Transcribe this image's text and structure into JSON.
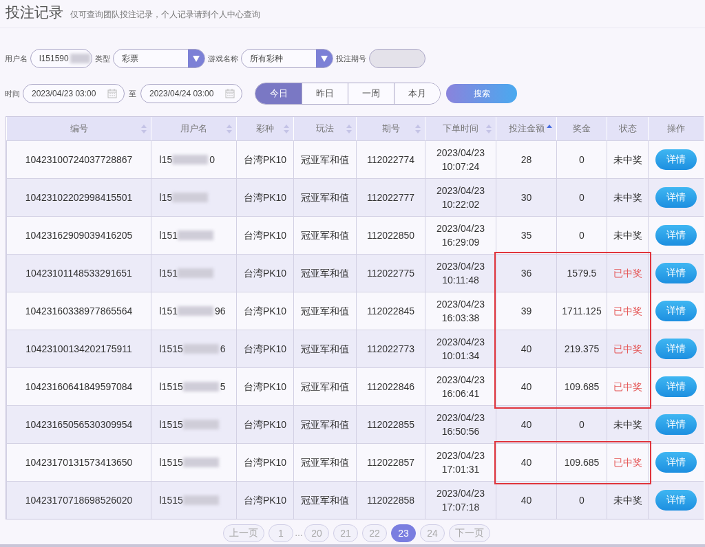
{
  "title": "投注记录",
  "subtitle": "仅可查询团队投注记录，个人记录请到个人中心查询",
  "filters": {
    "username_label": "用户名",
    "username_value": "l151590",
    "type_label": "类型",
    "type_value": "彩票",
    "game_label": "游戏名称",
    "game_value": "所有彩种",
    "period_label": "投注期号",
    "time_label": "时间",
    "start": "2023/04/23 03:00",
    "to_label": "至",
    "end": "2023/04/24 03:00",
    "ranges": [
      {
        "label": "今日",
        "selected": true
      },
      {
        "label": "昨日",
        "selected": false
      },
      {
        "label": "一周",
        "selected": false
      },
      {
        "label": "本月",
        "selected": false
      }
    ],
    "search": "搜索"
  },
  "table": {
    "columns": [
      {
        "label": "编号",
        "kind": "sortable",
        "sorted": false
      },
      {
        "label": "用户名",
        "kind": "sortable",
        "sorted": false
      },
      {
        "label": "彩种",
        "kind": "sortable",
        "sorted": false
      },
      {
        "label": "玩法",
        "kind": "sortable",
        "sorted": false
      },
      {
        "label": "期号",
        "kind": "sortable",
        "sorted": false
      },
      {
        "label": "下单时间",
        "kind": "sortable",
        "sorted": false
      },
      {
        "label": "投注金额",
        "kind": "sortable",
        "sorted": true
      },
      {
        "label": "奖金",
        "kind": "plain"
      },
      {
        "label": "状态",
        "kind": "plain"
      },
      {
        "label": "操作",
        "kind": "plain"
      }
    ],
    "rows": [
      {
        "id": "10423100724037728867",
        "user": "l15",
        "user_tail": "0",
        "lottery": "台湾PK10",
        "play": "冠亚军和值",
        "issue": "112022774",
        "date": "2023/04/23",
        "time": "10:07:24",
        "amount": "28",
        "prize": "0",
        "status": "未中奖",
        "won": false,
        "boxed": false,
        "action": "详情"
      },
      {
        "id": "10423102202998415501",
        "user": "l15",
        "user_tail": "",
        "lottery": "台湾PK10",
        "play": "冠亚军和值",
        "issue": "112022777",
        "date": "2023/04/23",
        "time": "10:22:02",
        "amount": "30",
        "prize": "0",
        "status": "未中奖",
        "won": false,
        "boxed": false,
        "action": "详情"
      },
      {
        "id": "10423162909039416205",
        "user": "l151",
        "user_tail": "",
        "lottery": "台湾PK10",
        "play": "冠亚军和值",
        "issue": "112022850",
        "date": "2023/04/23",
        "time": "16:29:09",
        "amount": "35",
        "prize": "0",
        "status": "未中奖",
        "won": false,
        "boxed": false,
        "action": "详情"
      },
      {
        "id": "10423101148533291651",
        "user": "l151",
        "user_tail": "",
        "lottery": "台湾PK10",
        "play": "冠亚军和值",
        "issue": "112022775",
        "date": "2023/04/23",
        "time": "10:11:48",
        "amount": "36",
        "prize": "1579.5",
        "status": "已中奖",
        "won": true,
        "boxed": true,
        "action": "详情"
      },
      {
        "id": "10423160338977865564",
        "user": "l151",
        "user_tail": "96",
        "lottery": "台湾PK10",
        "play": "冠亚军和值",
        "issue": "112022845",
        "date": "2023/04/23",
        "time": "16:03:38",
        "amount": "39",
        "prize": "1711.125",
        "status": "已中奖",
        "won": true,
        "boxed": true,
        "action": "详情"
      },
      {
        "id": "10423100134202175911",
        "user": "l1515",
        "user_tail": "6",
        "lottery": "台湾PK10",
        "play": "冠亚军和值",
        "issue": "112022773",
        "date": "2023/04/23",
        "time": "10:01:34",
        "amount": "40",
        "prize": "219.375",
        "status": "已中奖",
        "won": true,
        "boxed": true,
        "action": "详情"
      },
      {
        "id": "10423160641849597084",
        "user": "l1515",
        "user_tail": "5",
        "lottery": "台湾PK10",
        "play": "冠亚军和值",
        "issue": "112022846",
        "date": "2023/04/23",
        "time": "16:06:41",
        "amount": "40",
        "prize": "109.685",
        "status": "已中奖",
        "won": true,
        "boxed": true,
        "action": "详情"
      },
      {
        "id": "10423165056530309954",
        "user": "l1515",
        "user_tail": "",
        "lottery": "台湾PK10",
        "play": "冠亚军和值",
        "issue": "112022855",
        "date": "2023/04/23",
        "time": "16:50:56",
        "amount": "40",
        "prize": "0",
        "status": "未中奖",
        "won": false,
        "boxed": false,
        "action": "详情"
      },
      {
        "id": "10423170131573413650",
        "user": "l1515",
        "user_tail": "",
        "lottery": "台湾PK10",
        "play": "冠亚军和值",
        "issue": "112022857",
        "date": "2023/04/23",
        "time": "17:01:31",
        "amount": "40",
        "prize": "109.685",
        "status": "已中奖",
        "won": true,
        "boxed": true,
        "action": "详情"
      },
      {
        "id": "10423170718698526020",
        "user": "l1515",
        "user_tail": "",
        "lottery": "台湾PK10",
        "play": "冠亚军和值",
        "issue": "112022858",
        "date": "2023/04/23",
        "time": "17:07:18",
        "amount": "40",
        "prize": "0",
        "status": "未中奖",
        "won": false,
        "boxed": false,
        "action": "详情"
      }
    ]
  },
  "pagination": {
    "prev": "上一页",
    "pages": [
      {
        "label": "1",
        "selected": false
      },
      {
        "label": "…",
        "kind": "gap"
      },
      {
        "label": "20",
        "selected": false
      },
      {
        "label": "21",
        "selected": false
      },
      {
        "label": "22",
        "selected": false
      },
      {
        "label": "23",
        "selected": true
      },
      {
        "label": "24",
        "selected": false
      }
    ],
    "next": "下一页"
  }
}
